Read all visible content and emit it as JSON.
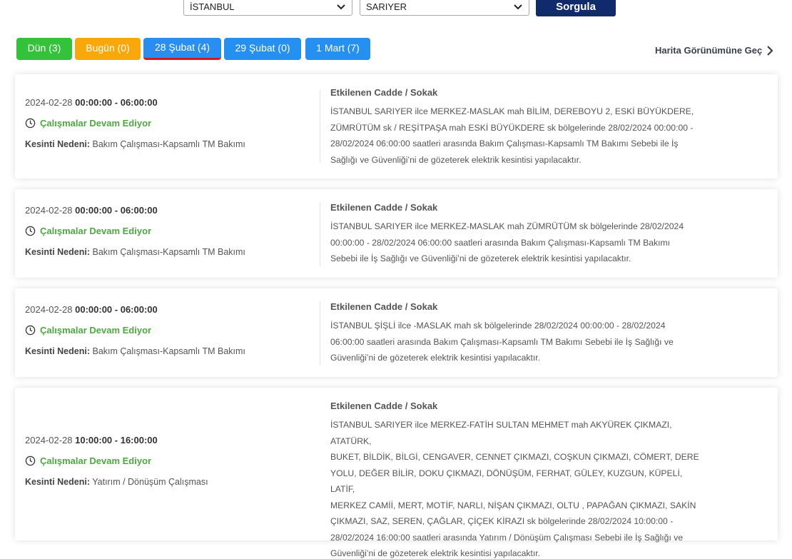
{
  "filters": {
    "city": "İSTANBUL",
    "district": "SARIYER",
    "query_label": "Sorgula"
  },
  "tabs": [
    {
      "label": "Dün (3)",
      "color": "#33c23a"
    },
    {
      "label": "Bugün (0)",
      "color": "#f9a80b"
    },
    {
      "label": "28 Şubat (4)",
      "color": "#2590f0",
      "active": true
    },
    {
      "label": "29 Şubat (0)",
      "color": "#2590f0"
    },
    {
      "label": "1 Mart (7)",
      "color": "#2590f0"
    }
  ],
  "map_link": "Harita Görünümüne Geç",
  "labels": {
    "street_title": "Etkilenen Cadde / Sokak",
    "reason_label": "Kesinti Nedeni:",
    "status": "Çalışmalar Devam Ediyor"
  },
  "outages": [
    {
      "date": "2024-02-28",
      "time": "00:00:00 - 06:00:00",
      "reason": "Bakım Çalışması-Kapsamlı TM Bakımı",
      "description_lines": [
        "İSTANBUL SARIYER ilce MERKEZ-MASLAK mah BİLİM, DEREBOYU 2, ESKİ BÜYÜKDERE,",
        "ZÜMRÜTÜM sk / REŞİTPAŞA mah ESKİ BÜYÜKDERE sk bölgelerinde 28/02/2024 00:00:00 -",
        "28/02/2024 06:00:00 saatleri arasında Bakım Çalışması-Kapsamlı TM Bakımı Sebebi ile İş",
        "Sağlığı ve Güvenliği’ni de gözeterek elektrik kesintisi yapılacaktır."
      ]
    },
    {
      "date": "2024-02-28",
      "time": "00:00:00 - 06:00:00",
      "reason": "Bakım Çalışması-Kapsamlı TM Bakımı",
      "description_lines": [
        "İSTANBUL SARIYER ilce MERKEZ-MASLAK mah ZÜMRÜTÜM sk bölgelerinde 28/02/2024",
        "00:00:00 - 28/02/2024 06:00:00 saatleri arasında Bakım Çalışması-Kapsamlı TM Bakımı",
        "Sebebi ile İş Sağlığı ve Güvenliği’ni de gözeterek elektrik kesintisi yapılacaktır."
      ]
    },
    {
      "date": "2024-02-28",
      "time": "00:00:00 - 06:00:00",
      "reason": "Bakım Çalışması-Kapsamlı TM Bakımı",
      "description_lines": [
        "İSTANBUL ŞİŞLİ ilce -MASLAK mah sk bölgelerinde 28/02/2024 00:00:00 - 28/02/2024",
        "06:00:00 saatleri arasında Bakım Çalışması-Kapsamlı TM Bakımı Sebebi ile İş Sağlığı ve",
        "Güvenliği’ni de gözeterek elektrik kesintisi yapılacaktır."
      ]
    },
    {
      "date": "2024-02-28",
      "time": "10:00:00 - 16:00:00",
      "reason": "Yatırım / Dönüşüm Çalışması",
      "description_lines": [
        "İSTANBUL SARIYER ilce MERKEZ-FATİH SULTAN MEHMET mah AKYÜREK ÇIKMAZI, ATATÜRK,",
        "BUKET, BİLDİK, BİLGİ, CENGAVER, CENNET ÇIKMAZI, COŞKUN ÇIKMAZI, CÖMERT, DERE",
        "YOLU, DEĞER BİLİR, DOKU ÇIKMAZI, DÖNÜŞÜM, FERHAT, GÜLEY, KUZGUN, KÜPELİ, LATİF,",
        "MERKEZ CAMİİ, MERT, MOTİF, NARLI, NİŞAN ÇIKMAZI, OLTU , PAPAĞAN ÇIKMAZI, SAKİN",
        "ÇIKMAZI, SAZ, SEREN, ÇAĞLAR, ÇİÇEK KİRAZI sk bölgelerinde 28/02/2024 10:00:00 -",
        "28/02/2024 16:00:00 saatleri arasında Yatırım / Dönüşüm Çalışması Sebebi ile İş Sağlığı ve",
        "Güvenliği’ni de gözeterek elektrik kesintisi yapılacaktır."
      ]
    }
  ]
}
